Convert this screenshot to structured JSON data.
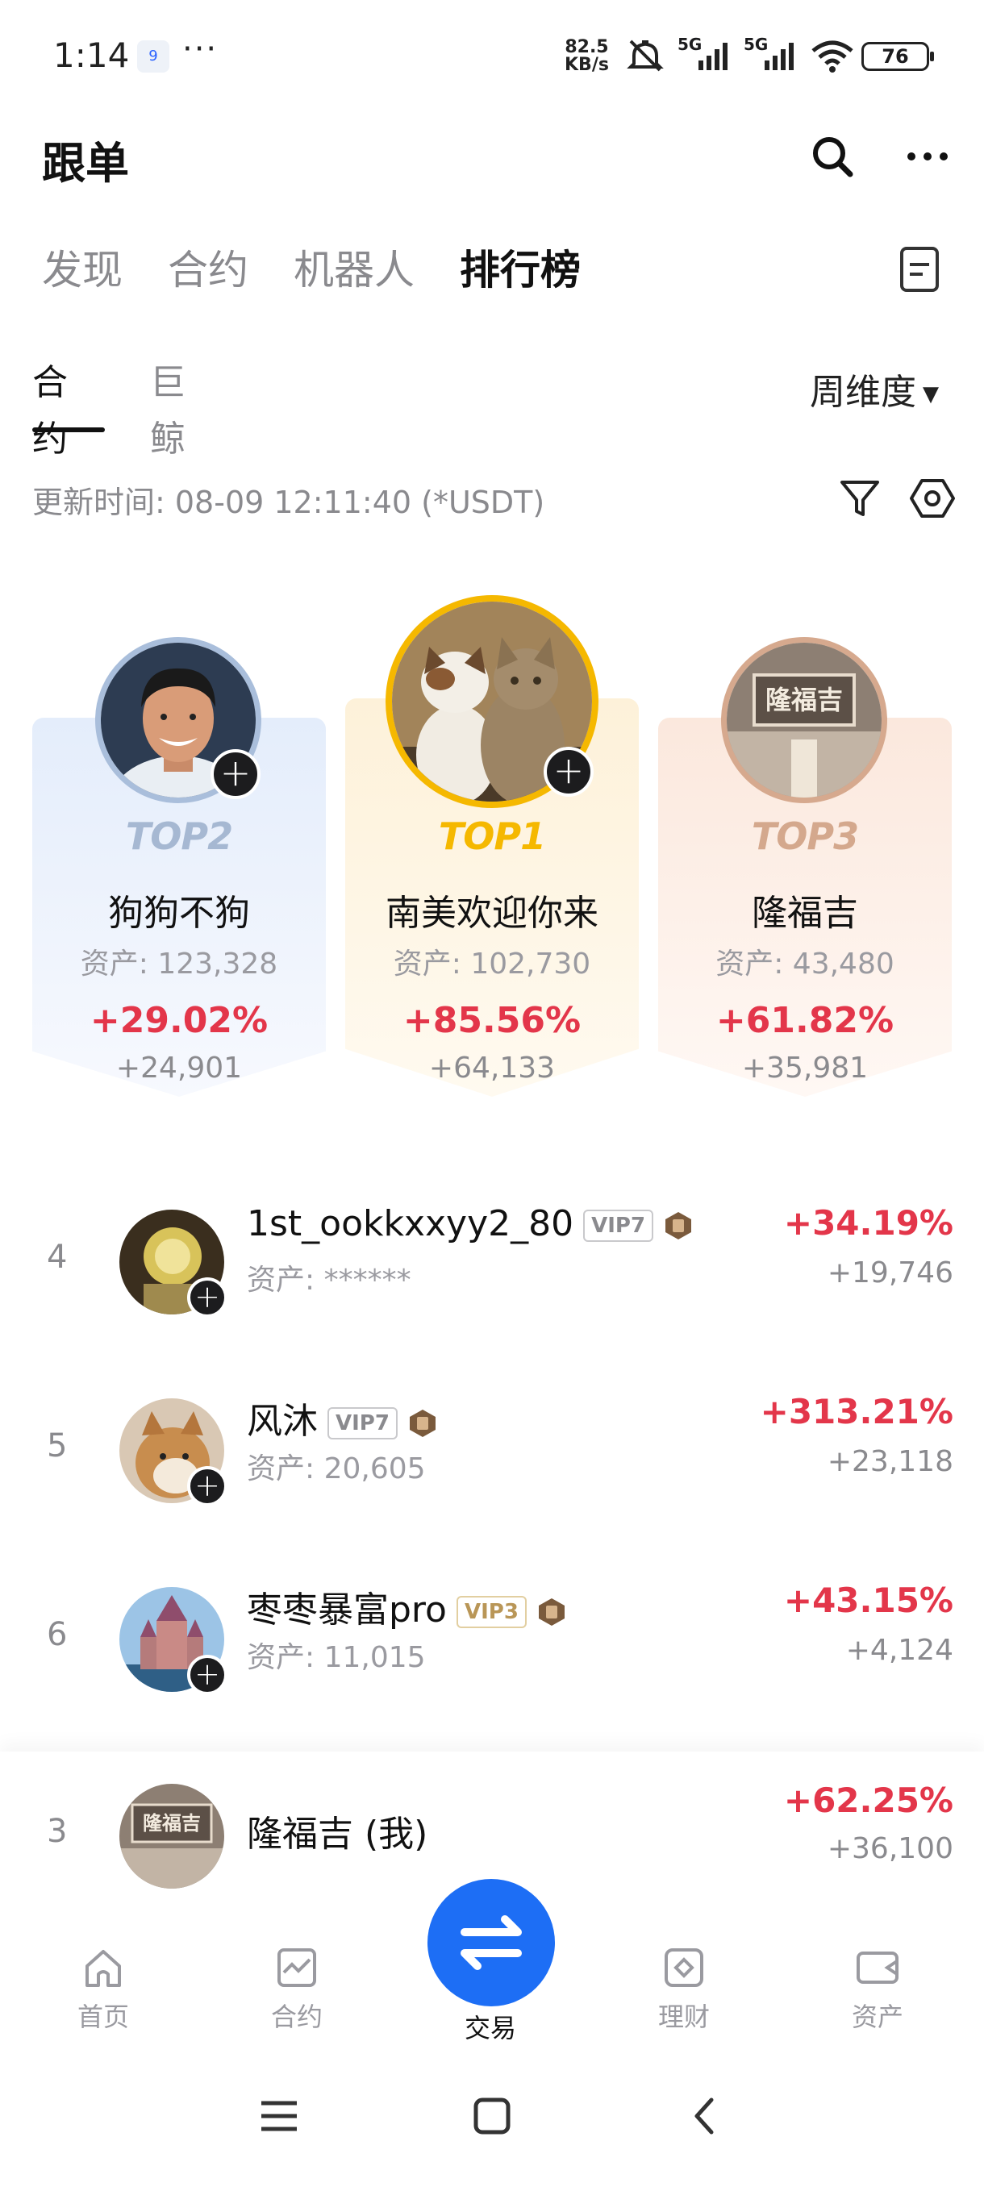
{
  "status_bar": {
    "time": "1:14",
    "notif_badge": "9",
    "more": "···",
    "net_speed_value": "82.5",
    "net_speed_unit": "KB/s",
    "signal1": "5G",
    "signal2": "5G",
    "battery": "76"
  },
  "header": {
    "title": "跟单"
  },
  "main_tabs": [
    "发现",
    "合约",
    "机器人",
    "排行榜"
  ],
  "sub_tabs": [
    "合约",
    "巨鲸"
  ],
  "period": "周维度",
  "update_time": "更新时间: 08-09 12:11:40 (*USDT)",
  "podium": [
    {
      "rank_label": "TOP2",
      "name": "狗狗不狗",
      "assets": "资产: 123,328",
      "pct": "+29.02%",
      "abs": "+24,901",
      "rank_color": "#a6b8d2"
    },
    {
      "rank_label": "TOP1",
      "name": "南美欢迎你来",
      "assets": "资产: 102,730",
      "pct": "+85.56%",
      "abs": "+64,133",
      "rank_color": "#f5b800"
    },
    {
      "rank_label": "TOP3",
      "name": "隆福吉",
      "assets": "资产: 43,480",
      "pct": "+61.82%",
      "abs": "+35,981",
      "rank_color": "#d4a88d"
    }
  ],
  "list": [
    {
      "rank": "4",
      "name": "1st_ookkxxyy2_80",
      "vip": "VIP7",
      "assets": "资产: ******",
      "pct": "+34.19%",
      "abs": "+19,746"
    },
    {
      "rank": "5",
      "name": "风沐",
      "vip": "VIP7",
      "assets": "资产: 20,605",
      "pct": "+313.21%",
      "abs": "+23,118"
    },
    {
      "rank": "6",
      "name": "枣枣暴富pro",
      "vip": "VIP3",
      "assets": "资产: 11,015",
      "pct": "+43.15%",
      "abs": "+4,124"
    }
  ],
  "my_row": {
    "rank": "3",
    "name": "隆福吉 (我)",
    "pct": "+62.25%",
    "abs": "+36,100",
    "avatar_text": "隆福吉"
  },
  "top3_avatar_text": "隆福吉",
  "bottom_nav": [
    "首页",
    "合约",
    "交易",
    "理财",
    "资产"
  ],
  "colors": {
    "up": "#e3364a",
    "accent": "#1d6ef5"
  }
}
